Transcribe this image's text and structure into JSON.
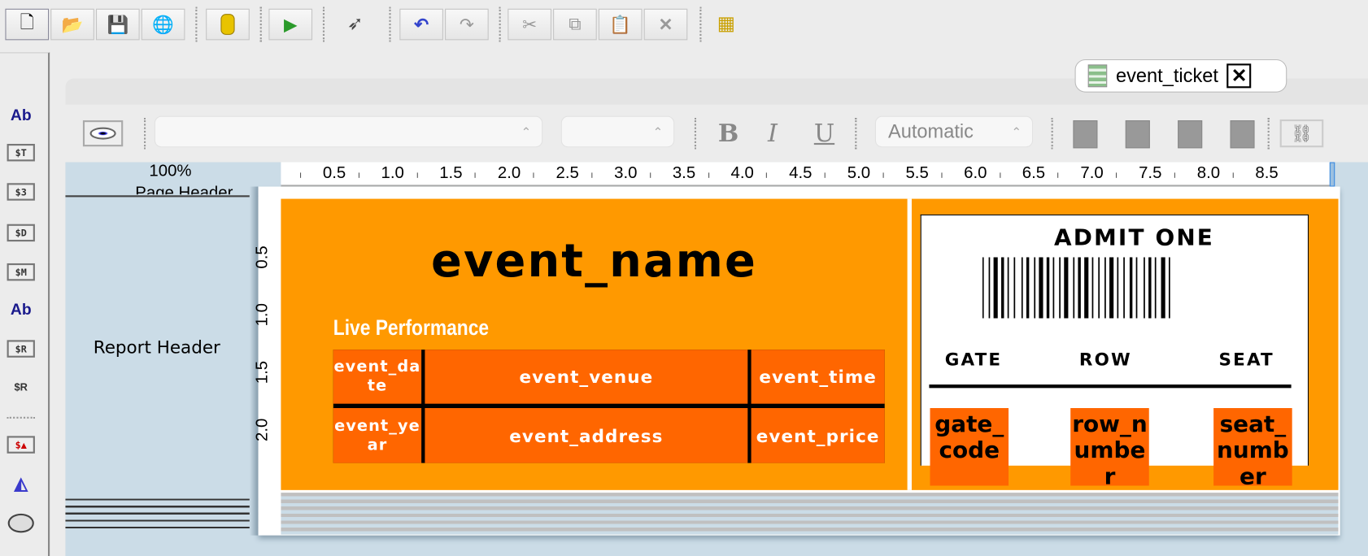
{
  "toolbar": {
    "buttons": [
      "new",
      "open",
      "save",
      "publish",
      "datasource",
      "run",
      "select",
      "undo",
      "redo",
      "cut",
      "copy",
      "paste",
      "delete",
      "data-table"
    ]
  },
  "tab": {
    "title": "event_ticket",
    "close": "✕"
  },
  "format_bar": {
    "font_family": "",
    "font_size": "",
    "bold": "B",
    "italic": "I",
    "underline": "U",
    "color": "Automatic"
  },
  "ruler": {
    "zoom": "100%",
    "h_ticks": [
      "0.5",
      "1.0",
      "1.5",
      "2.0",
      "2.5",
      "3.0",
      "3.5",
      "4.0",
      "4.5",
      "5.0",
      "5.5",
      "6.0",
      "6.5",
      "7.0",
      "7.5",
      "8.0",
      "8.5"
    ],
    "v_ticks": [
      "0.5",
      "1.0",
      "1.5",
      "2.0"
    ]
  },
  "bands": {
    "page_header": "Page Header",
    "report_header": "Report Header"
  },
  "report": {
    "event_name": "event_name",
    "subtitle": "Live Performance",
    "cells": {
      "date": "event_date",
      "venue": "event_venue",
      "time": "event_time",
      "year": "event_year",
      "address": "event_address",
      "price": "event_price"
    },
    "ticket": {
      "admit": "ADMIT ONE",
      "gate_label": "GATE",
      "row_label": "ROW",
      "seat_label": "SEAT",
      "gate": "gate_code",
      "row": "row_number",
      "seat": "seat_number"
    }
  },
  "colors": {
    "band": "#ff9900",
    "cell": "#ff6600"
  }
}
